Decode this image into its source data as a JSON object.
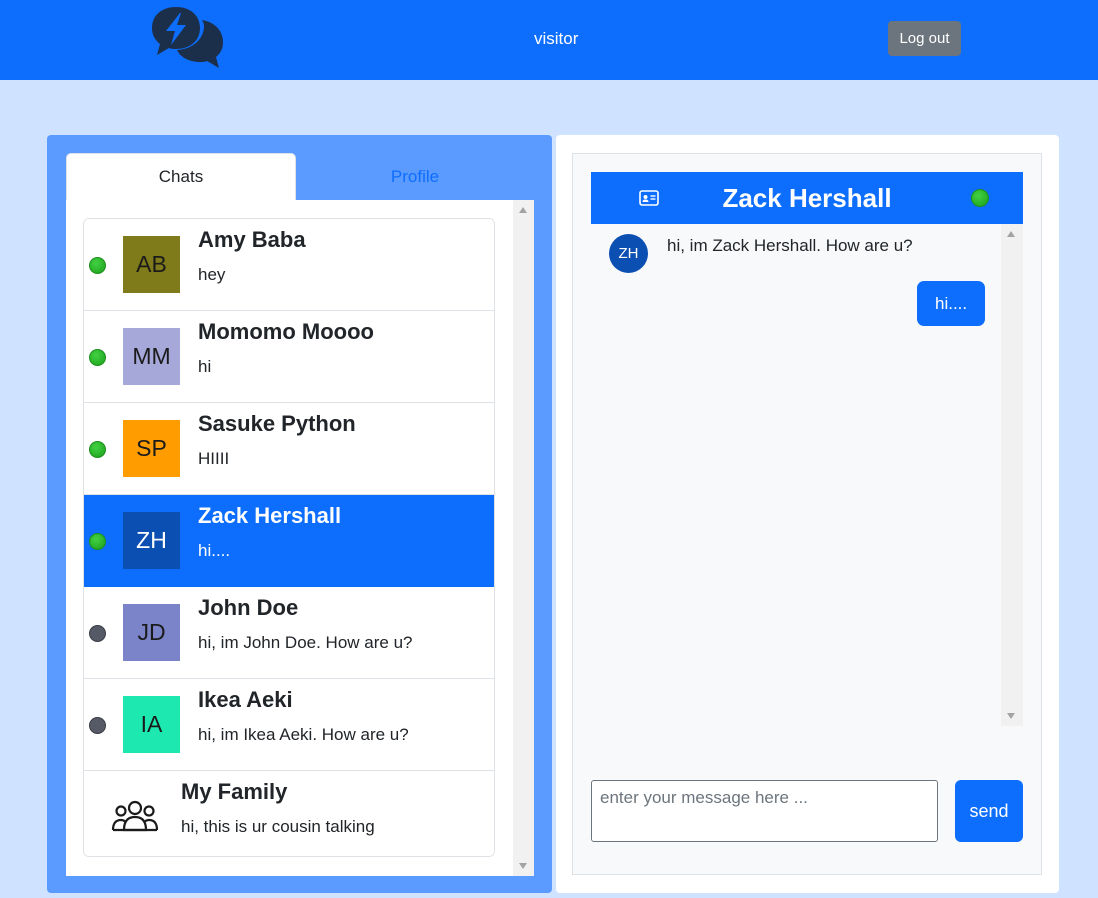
{
  "nav": {
    "username": "visitor",
    "logout_label": "Log out"
  },
  "tabs": {
    "chats": "Chats",
    "profile": "Profile"
  },
  "chats": [
    {
      "initials": "AB",
      "name": "Amy Baba",
      "last": "hey",
      "status": "online",
      "color": "#7f7a1a",
      "active": false
    },
    {
      "initials": "MM",
      "name": "Momomo Moooo",
      "last": "hi",
      "status": "online",
      "color": "#a5a8d8",
      "active": false
    },
    {
      "initials": "SP",
      "name": "Sasuke Python",
      "last": "HIIII",
      "status": "online",
      "color": "#ff9d00",
      "active": false
    },
    {
      "initials": "ZH",
      "name": "Zack Hershall",
      "last": "hi....",
      "status": "online",
      "color": "#0b4fb3",
      "active": true
    },
    {
      "initials": "JD",
      "name": "John Doe",
      "last": "hi, im John Doe. How are u?",
      "status": "offline",
      "color": "#7b83c9",
      "active": false
    },
    {
      "initials": "IA",
      "name": "Ikea Aeki",
      "last": "hi, im Ikea Aeki. How are u?",
      "status": "offline",
      "color": "#1de8b0",
      "active": false
    }
  ],
  "group": {
    "name": "My Family",
    "last": "hi, this is ur cousin talking",
    "icon": "group-icon"
  },
  "conversation": {
    "title": "Zack Hershall",
    "status": "online",
    "contact_initials": "ZH",
    "incoming": "hi, im Zack Hershall. How are u?",
    "outgoing": "hi...."
  },
  "composer": {
    "placeholder": "enter your message here ...",
    "send_label": "send"
  },
  "colors": {
    "primary": "#0d6efd",
    "page_bg": "#cfe2ff",
    "left_panel_bg": "#5b9bff",
    "online": "#22b022",
    "offline": "#555a66"
  }
}
